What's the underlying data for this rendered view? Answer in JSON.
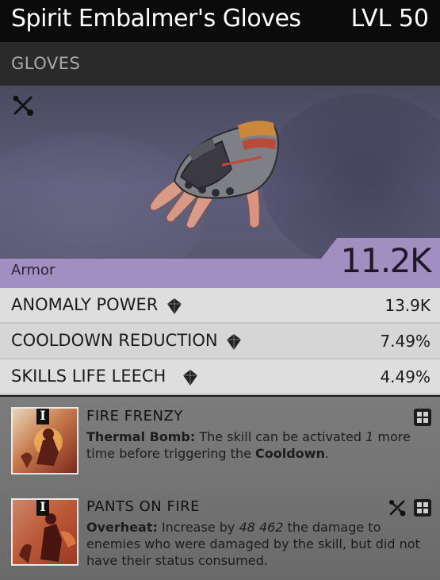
{
  "item": {
    "name": "Spirit Embalmer's Gloves",
    "level": "LVL 50",
    "type": "GLOVES",
    "armor_label": "Armor",
    "armor_value": "11.2K"
  },
  "icons": {
    "crafting": "crafting-tools-icon",
    "diamond": "diamond-gem-icon",
    "socket": "mod-socket-icon"
  },
  "colors": {
    "armor_band": "#a08fc0",
    "header_bg": "#0b0b0b"
  },
  "stats": [
    {
      "name": "ANOMALY POWER",
      "value": "13.9K"
    },
    {
      "name": "COOLDOWN REDUCTION",
      "value": "7.49%"
    },
    {
      "name": "SKILLS LIFE LEECH",
      "value": "4.49%"
    }
  ],
  "mods": [
    {
      "tier": "I",
      "title": "FIRE FRENZY",
      "skill": "Thermal Bomb:",
      "text_a": " The skill can be activated ",
      "number": "1",
      "text_b": " more time before triggering the ",
      "highlight": "Cooldown",
      "text_c": "."
    },
    {
      "tier": "I",
      "title": "PANTS ON FIRE",
      "skill": "Overheat:",
      "text_a": " Increase by ",
      "number": "48 462",
      "text_b": " the damage to enemies who were damaged by the skill, but did not have their status consumed.",
      "highlight": "",
      "text_c": ""
    }
  ]
}
